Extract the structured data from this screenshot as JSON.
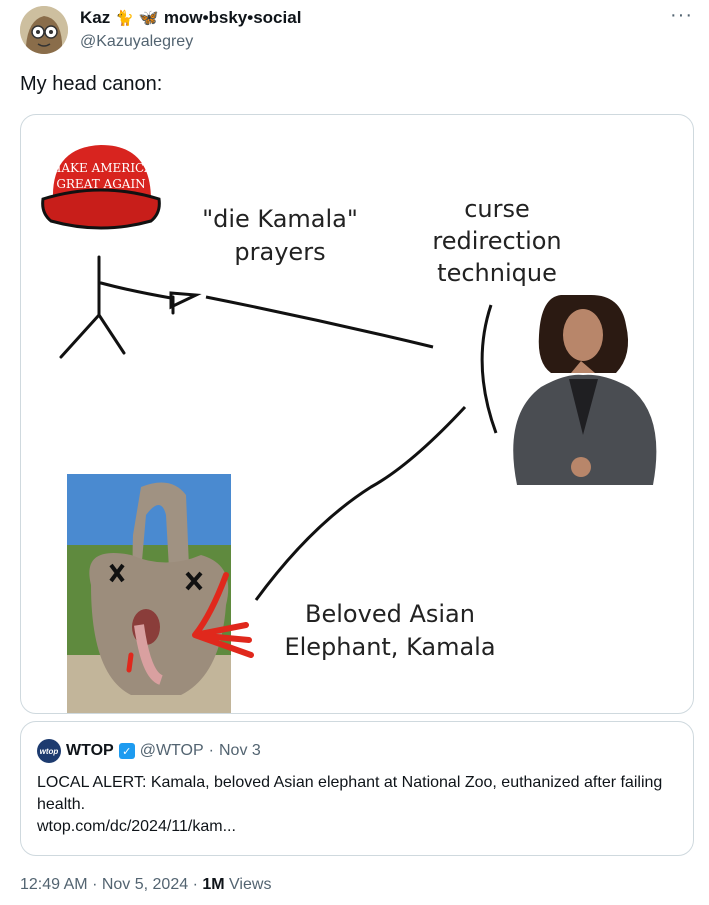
{
  "author": {
    "name": "Kaz",
    "name_suffix": "mow•bsky•social",
    "handle": "@Kazuyalegrey"
  },
  "tweet": {
    "text": "My head canon:"
  },
  "image": {
    "hat_text_line1": "MAKE AMERICA",
    "hat_text_line2": "GREAT AGAIN",
    "label_prayers_1": "\"die Kamala\"",
    "label_prayers_2": "prayers",
    "label_curse_1": "curse",
    "label_curse_2": "redirection",
    "label_curse_3": "technique",
    "label_elephant_1": "Beloved Asian",
    "label_elephant_2": "Elephant, Kamala"
  },
  "quote": {
    "logo_text": "wtop",
    "name": "WTOP",
    "handle": "@WTOP",
    "separator": "·",
    "date": "Nov 3",
    "body": "LOCAL ALERT: Kamala, beloved Asian elephant at National Zoo, euthanized after failing health.",
    "link": "wtop.com/dc/2024/11/kam..."
  },
  "footer": {
    "time": "12:49 AM",
    "sep1": "·",
    "date": "Nov 5, 2024",
    "sep2": "·",
    "views_count": "1M",
    "views_label": "Views"
  },
  "colors": {
    "accent": "#1d9bf0",
    "secondary_text": "#536471",
    "border": "#cfd9de"
  }
}
